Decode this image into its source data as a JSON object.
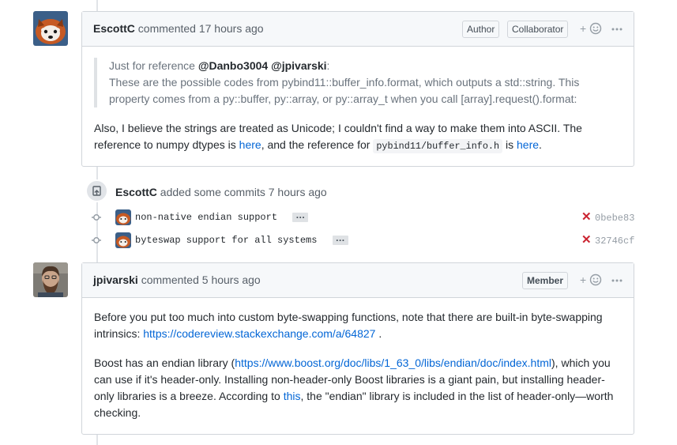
{
  "comment1": {
    "author": "EscottC",
    "action": "commented",
    "time": "17 hours ago",
    "badges": [
      "Author",
      "Collaborator"
    ],
    "quote_intro": "Just for reference",
    "quote_mentions": "@Danbo3004 @jpivarski",
    "quote_colon": ":",
    "quote_text": "These are the possible codes from pybind11::buffer_info.format, which outputs a std::string. This property comes from a py::buffer, py::array, or py::array_t when you call [array].request().format:",
    "para_text1": "Also, I believe the strings are treated as Unicode; I couldn't find a way to make them into ASCII. The reference to numpy dtypes is",
    "link_here1": "here",
    "para_text2": ", and the reference for",
    "code": "pybind11/buffer_info.h",
    "para_text3": "is",
    "link_here2": "here",
    "para_end": "."
  },
  "commits_event": {
    "author": "EscottC",
    "text": "added some commits",
    "time": "7 hours ago",
    "commits": [
      {
        "message": "non-native endian support",
        "sha": "0bebe83",
        "status": "failed"
      },
      {
        "message": "byteswap support for all systems",
        "sha": "32746cf",
        "status": "failed"
      }
    ]
  },
  "comment2": {
    "author": "jpivarski",
    "action": "commented",
    "time": "5 hours ago",
    "badges": [
      "Member"
    ],
    "p1_text": "Before you put too much into custom byte-swapping functions, note that there are built-in byte-swapping intrinsics:",
    "p1_link": "https://codereview.stackexchange.com/a/64827",
    "p1_end": ".",
    "p2_text1": "Boost has an endian library (",
    "p2_link1": "https://www.boost.org/doc/libs/1_63_0/libs/endian/doc/index.html",
    "p2_text2": "), which you can use if it's header-only. Installing non-header-only Boost libraries is a giant pain, but installing header-only libraries is a breeze. According to",
    "p2_link2": "this",
    "p2_text3": ", the \"endian\" library is included in the list of header-only—worth checking."
  },
  "icons": {
    "reaction": "smiley-icon",
    "more": "kebab-horizontal-icon",
    "commit": "git-commit-icon",
    "push": "repo-push-icon",
    "failed": "x-icon"
  },
  "colors": {
    "link": "#0366d6",
    "fail": "#cb2431",
    "header_bg": "#f6f8fa",
    "border": "#d1d5da"
  }
}
